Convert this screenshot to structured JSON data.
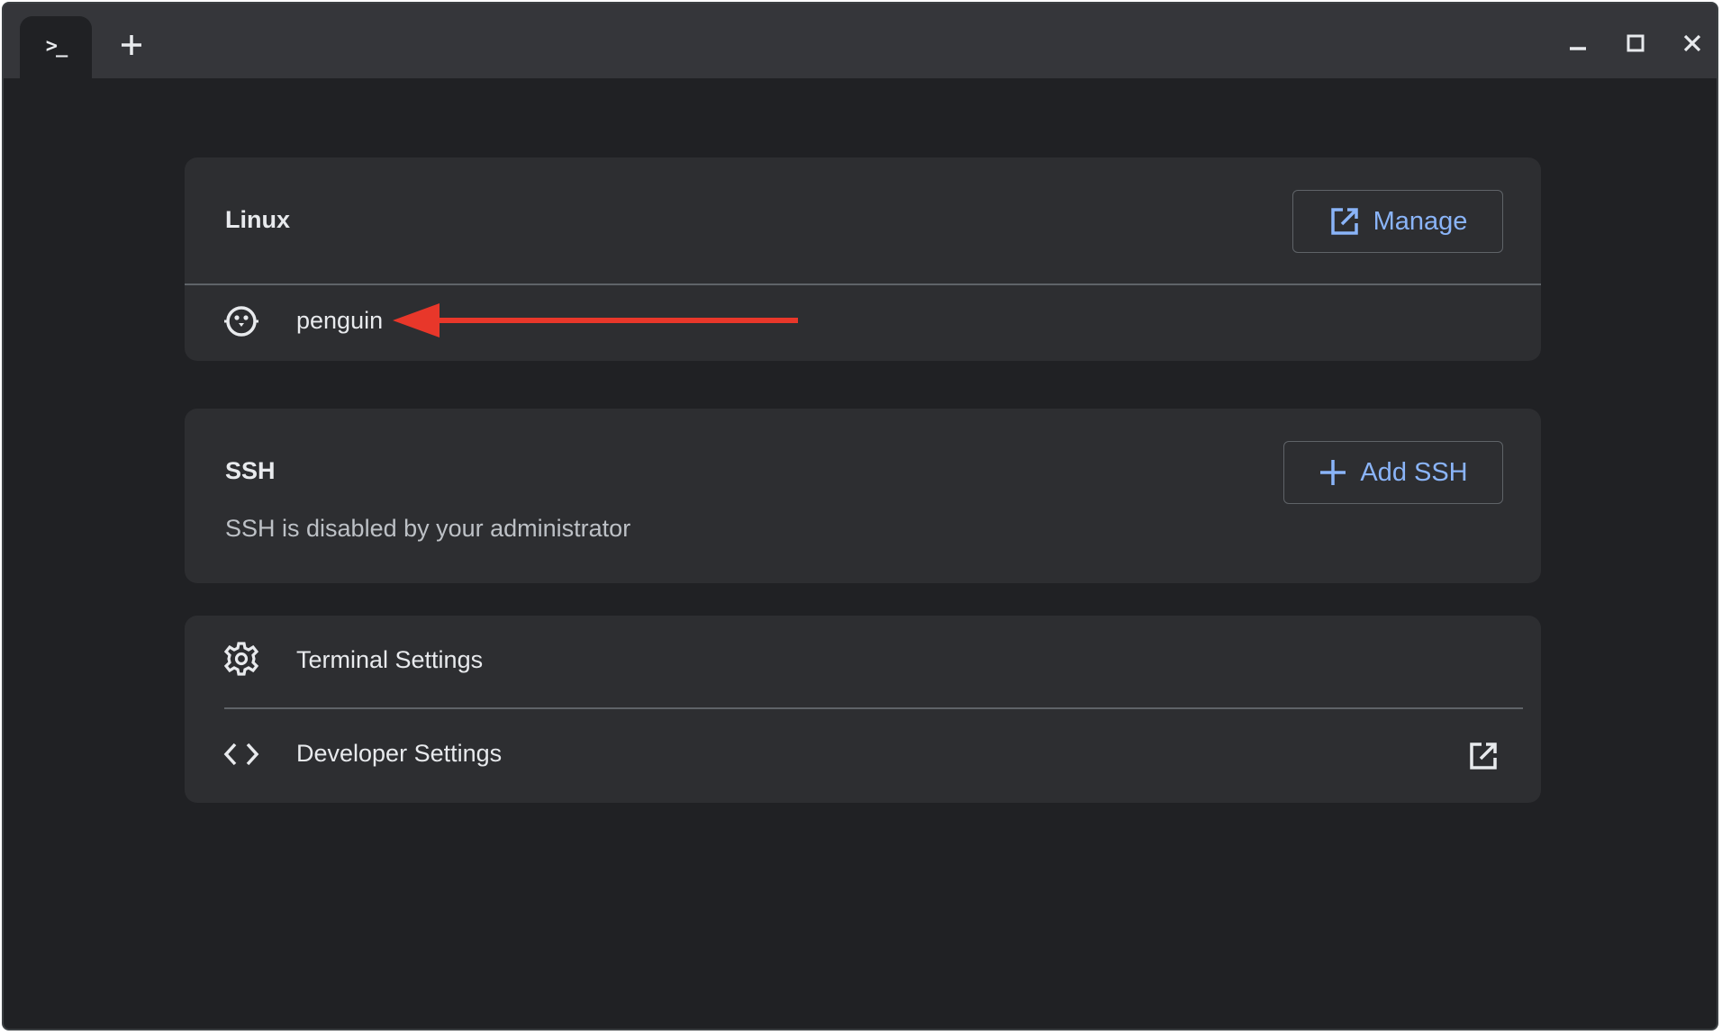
{
  "titlebar": {
    "tab_icon": "terminal-prompt-icon",
    "tab_glyph": ">_",
    "new_tab_icon": "plus-icon",
    "controls": [
      "minimize-icon",
      "maximize-icon",
      "close-icon"
    ]
  },
  "linux": {
    "title": "Linux",
    "manage_button": {
      "label": "Manage",
      "icon": "open-external-icon"
    },
    "containers": [
      {
        "name": "penguin",
        "icon": "penguin-icon"
      }
    ]
  },
  "ssh": {
    "title": "SSH",
    "add_button": {
      "label": "Add SSH",
      "icon": "plus-icon"
    },
    "status_text": "SSH is disabled by your administrator"
  },
  "settings": {
    "items": [
      {
        "label": "Terminal Settings",
        "icon": "gear-icon"
      },
      {
        "label": "Developer Settings",
        "icon": "code-brackets-icon",
        "trailing_icon": "open-external-icon"
      }
    ]
  },
  "colors": {
    "window_bg": "#202124",
    "titlebar_bg": "#35363a",
    "card_bg": "#2d2e31",
    "accent": "#8ab4f8",
    "annotation_arrow": "#e8372a"
  }
}
